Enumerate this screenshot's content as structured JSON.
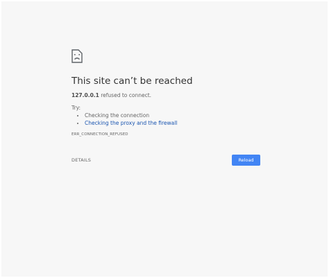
{
  "error": {
    "title": "This site can’t be reached",
    "host": "127.0.0.1",
    "summary_suffix": " refused to connect.",
    "try_label": "Try:",
    "suggestions": [
      {
        "label": "Checking the connection",
        "is_link": false
      },
      {
        "label": "Checking the proxy and the firewall",
        "is_link": true
      }
    ],
    "error_code": "ERR_CONNECTION_REFUSED"
  },
  "buttons": {
    "details_label": "DETAILS",
    "reload_label": "Reload"
  },
  "icons": {
    "main": "sad-page-icon"
  },
  "colors": {
    "background": "#f7f7f7",
    "link": "#1a55b0",
    "reload_button": "#4285f4"
  }
}
